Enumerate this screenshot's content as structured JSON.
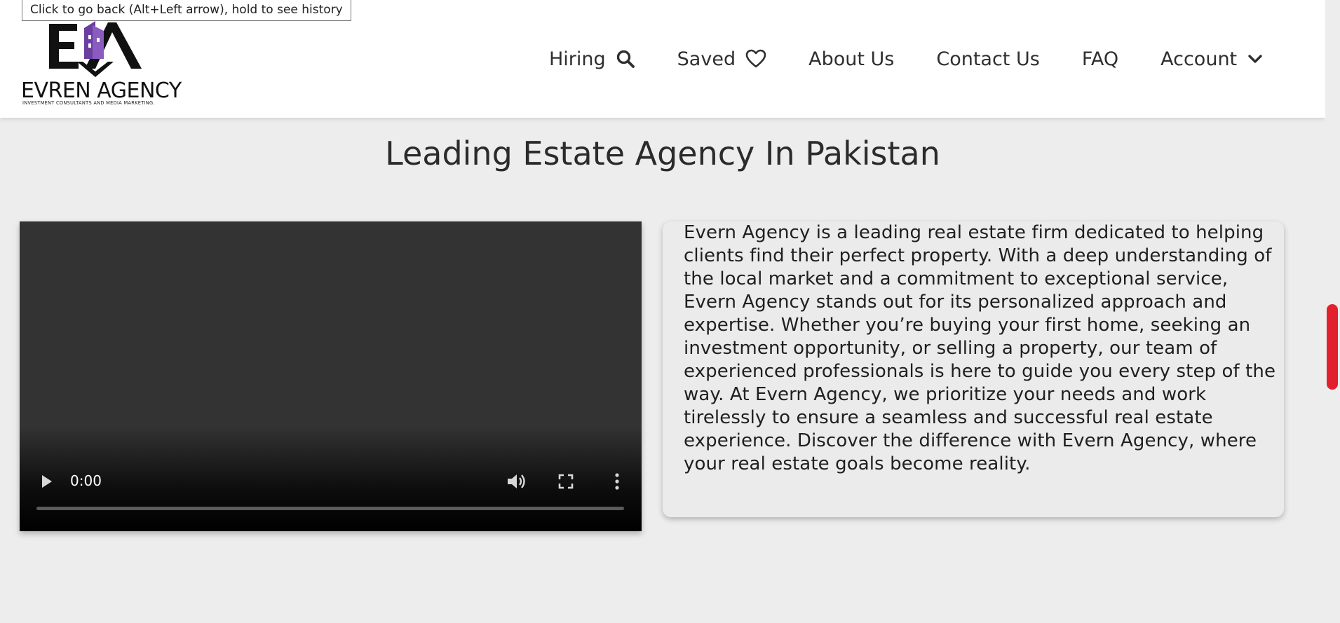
{
  "tooltip": {
    "text": "Click to go back (Alt+Left arrow), hold to see history"
  },
  "logo": {
    "monogram": "EA",
    "name": "EVREN AGENCY",
    "tagline": "INVESTMENT CONSULTANTS AND MEDIA MARKETING.",
    "accent_color": "#6b3fa0"
  },
  "nav": {
    "items": [
      {
        "label": "Hiring",
        "icon": "search-icon"
      },
      {
        "label": "Saved",
        "icon": "heart-icon"
      },
      {
        "label": "About Us"
      },
      {
        "label": "Contact Us"
      },
      {
        "label": "FAQ"
      },
      {
        "label": "Account",
        "icon": "chevron-down-icon"
      }
    ]
  },
  "main": {
    "title": "Leading Estate Agency In Pakistan",
    "video": {
      "time": "0:00",
      "progress": 0
    },
    "description": "Evern Agency is a leading real estate firm dedicated to helping clients find their perfect property. With a deep understanding of the local market and a commitment to exceptional service, Evern Agency stands out for its personalized approach and expertise. Whether you’re buying your first home, seeking an investment opportunity, or selling a property, our team of experienced professionals is here to guide you every step of the way. At Evern Agency, we prioritize your needs and work tirelessly to ensure a seamless and successful real estate experience. Discover the difference with Evern Agency, where your real estate goals become reality."
  },
  "colors": {
    "page_background": "#ededed",
    "header_background": "#ffffff",
    "scrollbar_thumb": "#e2212e"
  }
}
